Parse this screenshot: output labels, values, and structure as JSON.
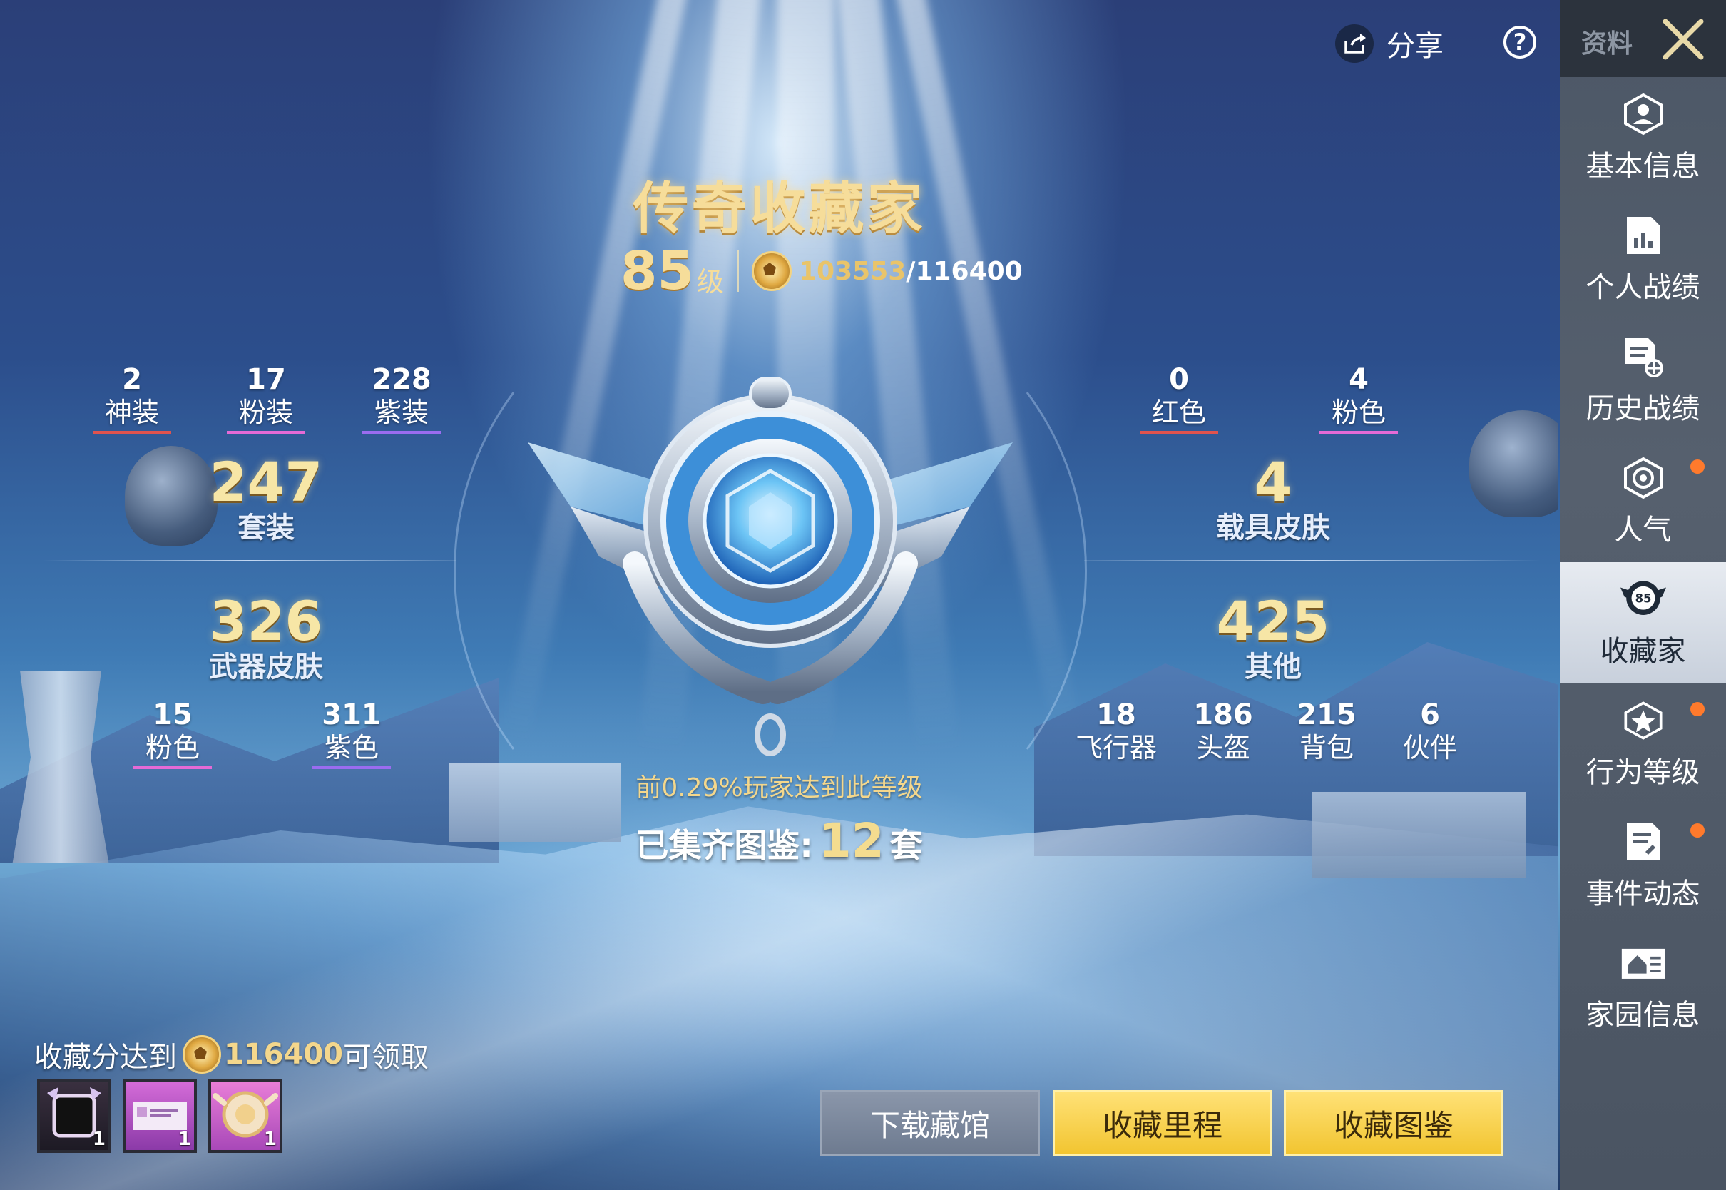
{
  "header": {
    "share_label": "分享",
    "help_label": "?"
  },
  "title": "传奇收藏家",
  "level": {
    "value": "85",
    "unit": "级"
  },
  "score": {
    "current": "103553",
    "max": "/116400"
  },
  "left_top_stats": [
    {
      "value": "2",
      "label": "神装",
      "color": "#e0534e"
    },
    {
      "value": "17",
      "label": "粉装",
      "color": "#e56ad6"
    },
    {
      "value": "228",
      "label": "紫装",
      "color": "#9a6cf0"
    }
  ],
  "suits": {
    "value": "247",
    "label": "套装"
  },
  "weapon_skins": {
    "value": "326",
    "label": "武器皮肤"
  },
  "left_bottom_stats": [
    {
      "value": "15",
      "label": "粉色",
      "color": "#e56ad6"
    },
    {
      "value": "311",
      "label": "紫色",
      "color": "#9a6cf0"
    }
  ],
  "right_top_stats": [
    {
      "value": "0",
      "label": "红色",
      "color": "#e0534e"
    },
    {
      "value": "4",
      "label": "粉色",
      "color": "#e56ad6"
    }
  ],
  "vehicle_skins": {
    "value": "4",
    "label": "载具皮肤"
  },
  "others": {
    "value": "425",
    "label": "其他"
  },
  "right_bottom_stats": [
    {
      "value": "18",
      "label": "飞行器"
    },
    {
      "value": "186",
      "label": "头盔"
    },
    {
      "value": "215",
      "label": "背包"
    },
    {
      "value": "6",
      "label": "伙伴"
    }
  ],
  "rank_text": "前0.29%玩家达到此等级",
  "collected": {
    "prefix": "已集齐图鉴:",
    "value": "12",
    "suffix": "套"
  },
  "reward": {
    "prefix": "收藏分达到",
    "value": "116400",
    "suffix": "可领取",
    "items": [
      {
        "count": "1"
      },
      {
        "count": "1"
      },
      {
        "count": "1"
      }
    ]
  },
  "buttons": {
    "download": "下载藏馆",
    "milestone": "收藏里程",
    "catalog": "收藏图鉴"
  },
  "sidebar": {
    "header": "资料",
    "items": [
      {
        "label": "基本信息",
        "icon": "profile-icon",
        "dot": false
      },
      {
        "label": "个人战绩",
        "icon": "stats-icon",
        "dot": false
      },
      {
        "label": "历史战绩",
        "icon": "history-icon",
        "dot": false
      },
      {
        "label": "人气",
        "icon": "popularity-icon",
        "dot": true
      },
      {
        "label": "收藏家",
        "icon": "collector-icon",
        "dot": false,
        "badge": "85"
      },
      {
        "label": "行为等级",
        "icon": "behavior-icon",
        "dot": true
      },
      {
        "label": "事件动态",
        "icon": "events-icon",
        "dot": true
      },
      {
        "label": "家园信息",
        "icon": "home-icon",
        "dot": false
      }
    ]
  }
}
